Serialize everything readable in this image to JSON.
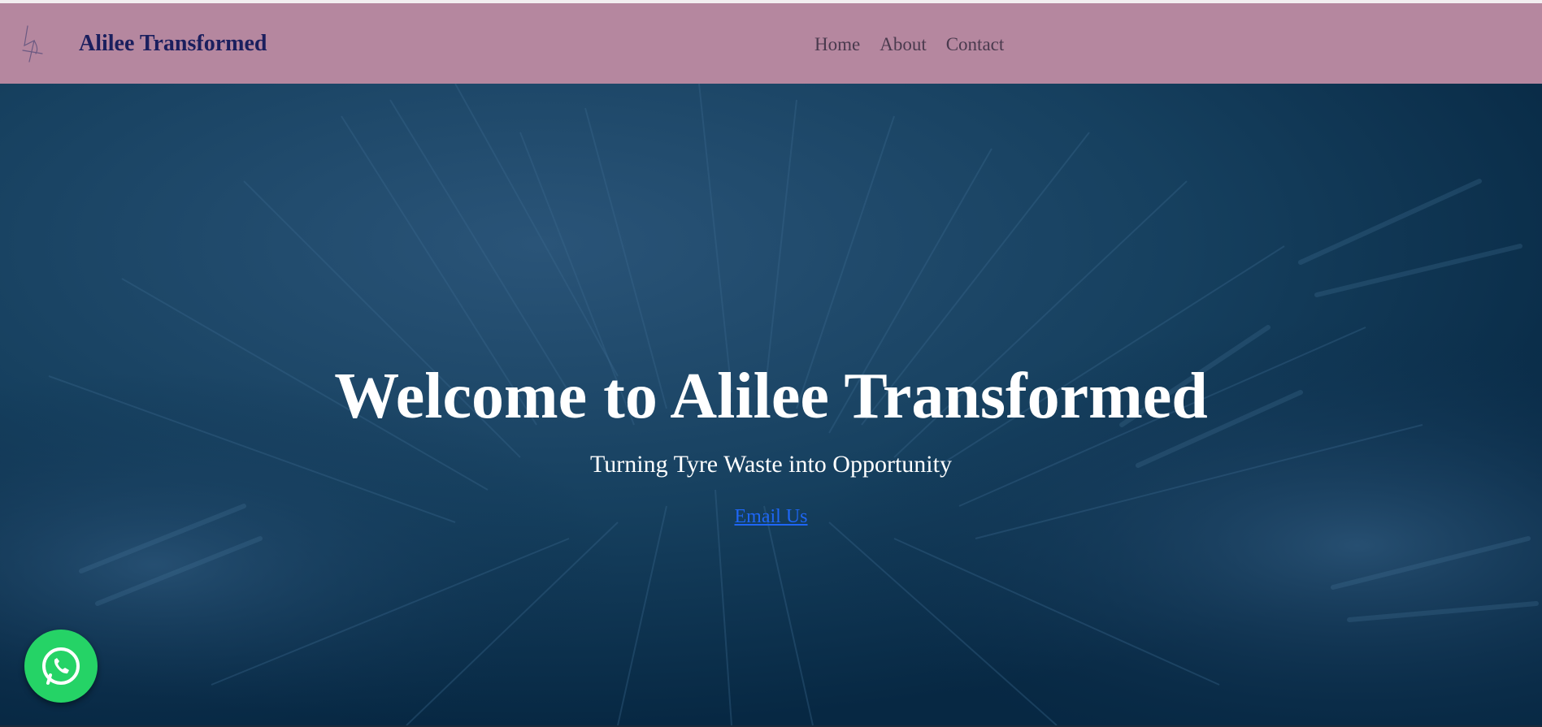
{
  "header": {
    "brand": "Alilee Transformed",
    "logo_icon": "signature-logo-icon",
    "nav": [
      {
        "label": "Home"
      },
      {
        "label": "About"
      },
      {
        "label": "Contact"
      }
    ],
    "background_color": "#b5879f",
    "brand_color": "#1b1f5e"
  },
  "hero": {
    "title": "Welcome to Alilee Transformed",
    "subtitle": "Turning Tyre Waste into Opportunity",
    "cta_label": "Email Us",
    "background_color": "#0a2c4a",
    "link_color": "#1e66f5"
  },
  "floating": {
    "icon": "whatsapp-icon",
    "color": "#25d366"
  }
}
